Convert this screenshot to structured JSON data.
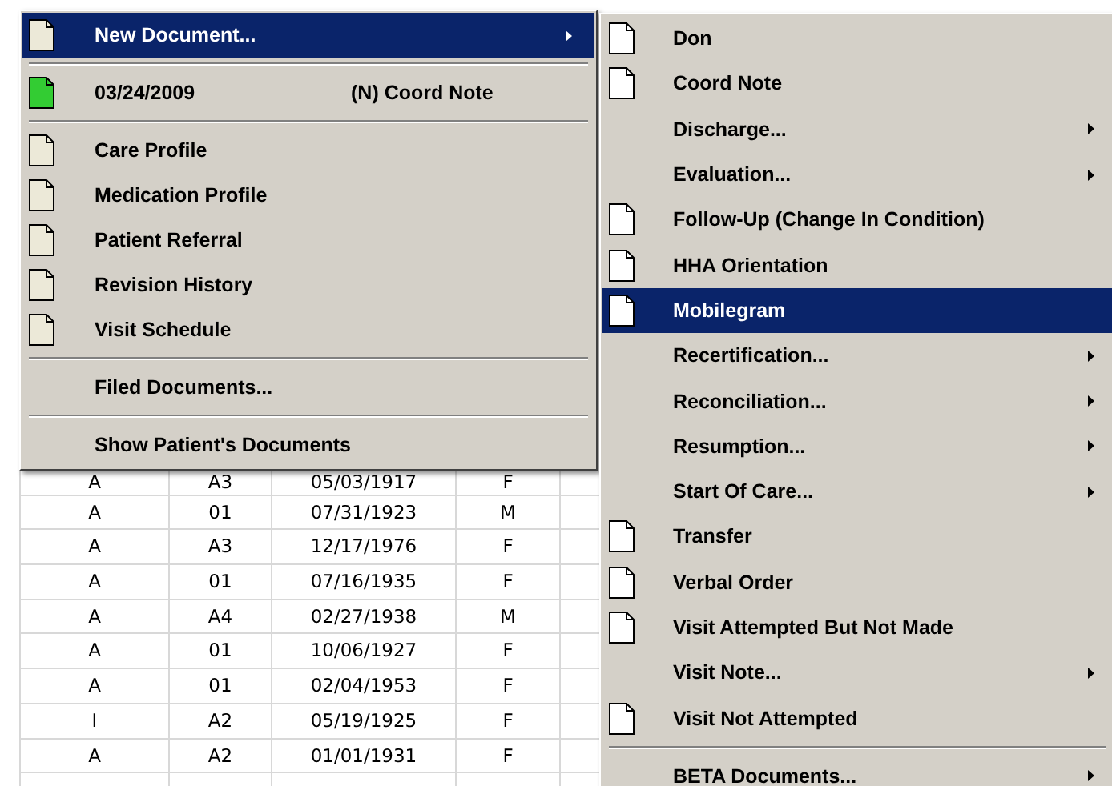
{
  "patient_table": {
    "rows": [
      {
        "cells": [
          "A",
          "A3",
          "05/03/1917",
          "F"
        ]
      },
      {
        "cells": [
          "A",
          "01",
          "07/31/1923",
          "M"
        ]
      },
      {
        "cells": [
          "A",
          "A3",
          "12/17/1976",
          "F"
        ]
      },
      {
        "cells": [
          "A",
          "01",
          "07/16/1935",
          "F"
        ]
      },
      {
        "cells": [
          "A",
          "A4",
          "02/27/1938",
          "M"
        ]
      },
      {
        "cells": [
          "A",
          "01",
          "10/06/1927",
          "F"
        ]
      },
      {
        "cells": [
          "A",
          "01",
          "02/04/1953",
          "F"
        ]
      },
      {
        "cells": [
          "I",
          "A2",
          "05/19/1925",
          "F"
        ]
      },
      {
        "cells": [
          "A",
          "A2",
          "01/01/1931",
          "F"
        ]
      }
    ]
  },
  "context_menu": {
    "groups": [
      {
        "items": [
          {
            "label": "New Document...",
            "kind": "document",
            "submenu": true,
            "selected": true
          }
        ]
      },
      {
        "items": [
          {
            "label": "03/24/2009",
            "detail": "(N) Coord Note",
            "kind": "document-green",
            "submenu": false,
            "selected": false
          }
        ]
      },
      {
        "items": [
          {
            "label": "Care Profile",
            "kind": "document",
            "submenu": false,
            "selected": false
          },
          {
            "label": "Medication Profile",
            "kind": "document",
            "submenu": false,
            "selected": false
          },
          {
            "label": "Patient Referral",
            "kind": "document",
            "submenu": false,
            "selected": false
          },
          {
            "label": "Revision History",
            "kind": "document",
            "submenu": false,
            "selected": false
          },
          {
            "label": "Visit Schedule",
            "kind": "document",
            "submenu": false,
            "selected": false
          }
        ]
      },
      {
        "items": [
          {
            "label": "Filed Documents...",
            "kind": "plain",
            "submenu": false,
            "selected": false
          }
        ]
      },
      {
        "items": [
          {
            "label": "Show Patient's Documents",
            "kind": "plain",
            "submenu": false,
            "selected": false
          }
        ]
      }
    ]
  },
  "new_document_submenu": {
    "groups": [
      {
        "items": [
          {
            "label": "Don",
            "kind": "document",
            "submenu": false,
            "selected": false
          },
          {
            "label": "Coord Note",
            "kind": "document",
            "submenu": false,
            "selected": false
          },
          {
            "label": "Discharge...",
            "kind": "plain",
            "submenu": true,
            "selected": false
          },
          {
            "label": "Evaluation...",
            "kind": "plain",
            "submenu": true,
            "selected": false
          },
          {
            "label": "Follow-Up (Change In Condition)",
            "kind": "document",
            "submenu": false,
            "selected": false
          },
          {
            "label": "HHA Orientation",
            "kind": "document",
            "submenu": false,
            "selected": false
          },
          {
            "label": "Mobilegram",
            "kind": "document",
            "submenu": false,
            "selected": true
          },
          {
            "label": "Recertification...",
            "kind": "plain",
            "submenu": true,
            "selected": false
          },
          {
            "label": "Reconciliation...",
            "kind": "plain",
            "submenu": true,
            "selected": false
          },
          {
            "label": "Resumption...",
            "kind": "plain",
            "submenu": true,
            "selected": false
          },
          {
            "label": "Start Of Care...",
            "kind": "plain",
            "submenu": true,
            "selected": false
          },
          {
            "label": "Transfer",
            "kind": "document",
            "submenu": false,
            "selected": false
          },
          {
            "label": "Verbal Order",
            "kind": "document",
            "submenu": false,
            "selected": false
          },
          {
            "label": "Visit Attempted But Not Made",
            "kind": "document",
            "submenu": false,
            "selected": false
          },
          {
            "label": "Visit Note...",
            "kind": "plain",
            "submenu": true,
            "selected": false
          },
          {
            "label": "Visit Not Attempted",
            "kind": "document",
            "submenu": false,
            "selected": false
          }
        ]
      },
      {
        "items": [
          {
            "label": "BETA Documents...",
            "kind": "plain",
            "submenu": true,
            "selected": false
          }
        ]
      }
    ]
  }
}
